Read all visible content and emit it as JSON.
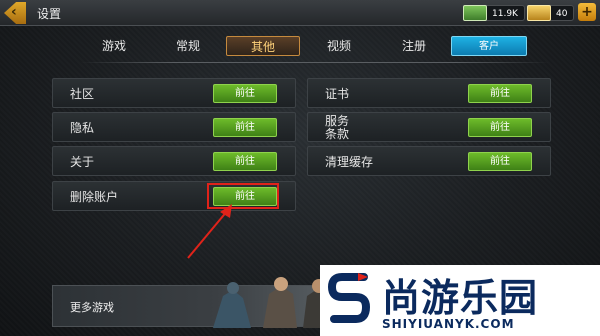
{
  "header": {
    "back_icon": "chevron-left-icon",
    "title": "设置",
    "cash": "11.9K",
    "gold": "40",
    "plus_label": "+"
  },
  "tabs": [
    {
      "label": "游戏",
      "active": false
    },
    {
      "label": "常规",
      "active": false
    },
    {
      "label": "其他",
      "active": true
    },
    {
      "label": "视频",
      "active": false
    },
    {
      "label": "注册",
      "active": false
    },
    {
      "label": "客户",
      "active": false
    }
  ],
  "left_items": [
    {
      "label": "社区",
      "button": "前往"
    },
    {
      "label": "隐私",
      "button": "前往"
    },
    {
      "label": "关于",
      "button": "前往"
    },
    {
      "label": "删除账户",
      "button": "前往"
    }
  ],
  "right_items": [
    {
      "label": "证书",
      "button": "前往"
    },
    {
      "label_line1": "服务",
      "label_line2": "条款",
      "button": "前往"
    },
    {
      "label": "清理缓存",
      "button": "前往"
    }
  ],
  "more_games": {
    "label": "更多游戏"
  },
  "watermark": {
    "cn": "尚游乐园",
    "en": "SHIYIUANYK.COM"
  },
  "colors": {
    "accent_green": "#5aa822",
    "active_tab": "#c58a3e",
    "highlight_red": "#e0231a",
    "blue_tab": "#1a9fd6"
  }
}
